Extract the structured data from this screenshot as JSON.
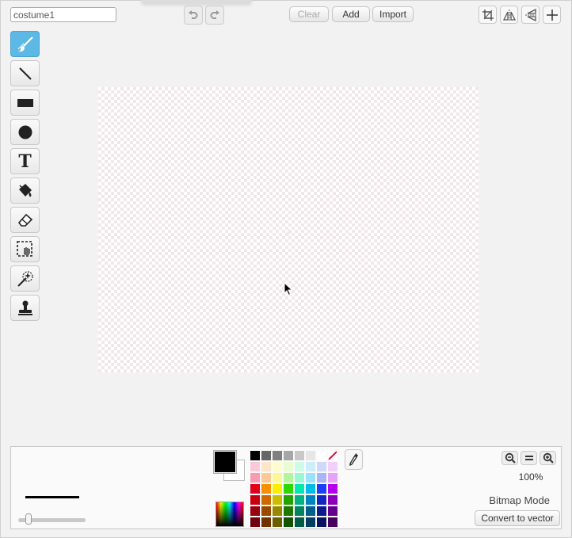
{
  "costume": {
    "name": "costume1"
  },
  "toolbar": {
    "clear_label": "Clear",
    "add_label": "Add",
    "import_label": "Import"
  },
  "tools": [
    {
      "name": "brush-tool",
      "icon": "brush-icon",
      "active": true
    },
    {
      "name": "line-tool",
      "icon": "line-icon"
    },
    {
      "name": "rectangle-tool",
      "icon": "rectangle-icon"
    },
    {
      "name": "ellipse-tool",
      "icon": "ellipse-icon"
    },
    {
      "name": "text-tool",
      "icon": "text-icon",
      "glyph": "T"
    },
    {
      "name": "fill-tool",
      "icon": "paint-bucket-icon"
    },
    {
      "name": "eraser-tool",
      "icon": "eraser-icon"
    },
    {
      "name": "select-tool",
      "icon": "select-icon"
    },
    {
      "name": "magic-select-tool",
      "icon": "magic-wand-icon"
    },
    {
      "name": "stamp-tool",
      "icon": "stamp-icon"
    }
  ],
  "colors": {
    "primary": "#000000",
    "secondary": "#ffffff",
    "active_tool": "#5cb8e4",
    "palette": [
      "#000000",
      "#666666",
      "#808080",
      "#a6a6a6",
      "#c8c8c8",
      "#e6e6e6",
      "#ffffff",
      "none",
      "#f9c8d9",
      "#fde5c8",
      "#fefccb",
      "#e8fcd0",
      "#ccfce8",
      "#cceefc",
      "#d0d8fc",
      "#f3d0fc",
      "#f79ab2",
      "#fbc995",
      "#fdf694",
      "#b2f59a",
      "#99f8d3",
      "#99e2f9",
      "#a8b6f9",
      "#e6a3f9",
      "#e0001c",
      "#f79000",
      "#fcee00",
      "#2dd800",
      "#00e7b1",
      "#00bbe9",
      "#1a3ffc",
      "#b400ee",
      "#c70010",
      "#cc6a00",
      "#cabd00",
      "#26a200",
      "#00b182",
      "#0084c0",
      "#1227c2",
      "#8a00b9",
      "#9b0010",
      "#9a4a00",
      "#978800",
      "#1c7a00",
      "#00855f",
      "#005e8e",
      "#0c1b8e",
      "#66008c",
      "#700010",
      "#703300",
      "#6b6000",
      "#135400",
      "#005c42",
      "#003f60",
      "#071360",
      "#48005f"
    ]
  },
  "zoom": {
    "level": "100%"
  },
  "mode": {
    "label": "Bitmap Mode",
    "convert_label": "Convert to vector"
  },
  "brush": {
    "size_level": 0.12
  }
}
